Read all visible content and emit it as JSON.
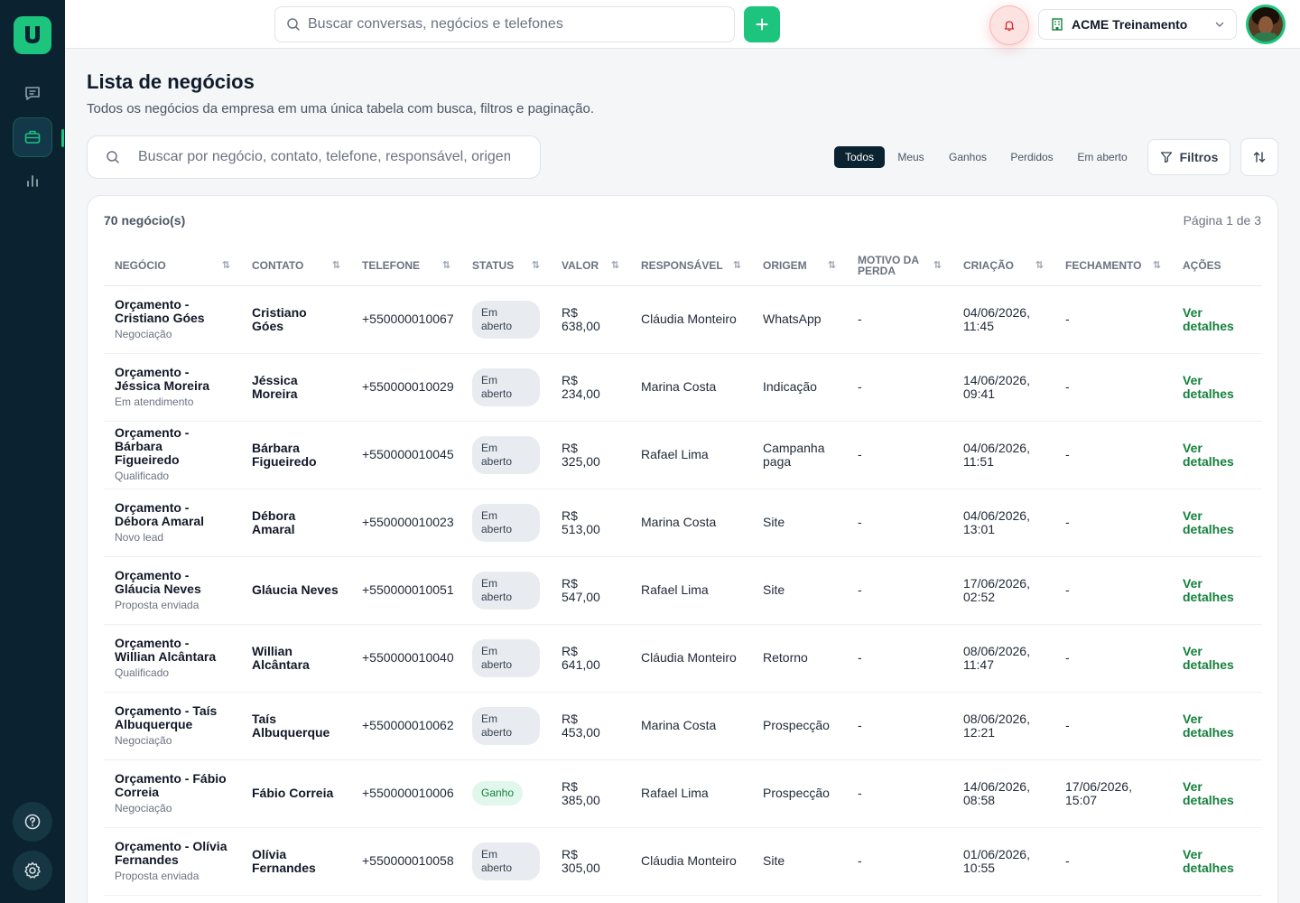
{
  "topbar": {
    "search_placeholder": "Buscar conversas, negócios e telefones",
    "company_name": "ACME Treinamento"
  },
  "page": {
    "title": "Lista de negócios",
    "subtitle": "Todos os negócios da empresa em uma única tabela com busca, filtros e paginação."
  },
  "filters": {
    "search_placeholder": "Buscar por negócio, contato, telefone, responsável, origem",
    "segments": [
      "Todos",
      "Meus",
      "Ganhos",
      "Perdidos",
      "Em aberto"
    ],
    "active_segment": "Todos",
    "filters_label": "Filtros"
  },
  "table": {
    "count_label": "70 negócio(s)",
    "pagination_label": "Página 1 de 3",
    "columns": [
      "Negócio",
      "Contato",
      "Telefone",
      "Status",
      "Valor",
      "Responsável",
      "Origem",
      "Motivo da perda",
      "Criação",
      "Fechamento",
      "Ações"
    ],
    "rows": [
      {
        "deal": "Orçamento - Cristiano Góes",
        "stage": "Negociação",
        "contact": "Cristiano Góes",
        "phone": "+550000010067",
        "status": "Em aberto",
        "value": "R$ 638,00",
        "owner": "Cláudia Monteiro",
        "origin": "WhatsApp",
        "loss_reason": "-",
        "created": "04/06/2026, 11:45",
        "closed": "-",
        "action": "Ver detalhes"
      },
      {
        "deal": "Orçamento - Jéssica Moreira",
        "stage": "Em atendimento",
        "contact": "Jéssica Moreira",
        "phone": "+550000010029",
        "status": "Em aberto",
        "value": "R$ 234,00",
        "owner": "Marina Costa",
        "origin": "Indicação",
        "loss_reason": "-",
        "created": "14/06/2026, 09:41",
        "closed": "-",
        "action": "Ver detalhes"
      },
      {
        "deal": "Orçamento - Bárbara Figueiredo",
        "stage": "Qualificado",
        "contact": "Bárbara Figueiredo",
        "phone": "+550000010045",
        "status": "Em aberto",
        "value": "R$ 325,00",
        "owner": "Rafael Lima",
        "origin": "Campanha paga",
        "loss_reason": "-",
        "created": "04/06/2026, 11:51",
        "closed": "-",
        "action": "Ver detalhes"
      },
      {
        "deal": "Orçamento - Débora Amaral",
        "stage": "Novo lead",
        "contact": "Débora Amaral",
        "phone": "+550000010023",
        "status": "Em aberto",
        "value": "R$ 513,00",
        "owner": "Marina Costa",
        "origin": "Site",
        "loss_reason": "-",
        "created": "04/06/2026, 13:01",
        "closed": "-",
        "action": "Ver detalhes"
      },
      {
        "deal": "Orçamento - Gláucia Neves",
        "stage": "Proposta enviada",
        "contact": "Gláucia Neves",
        "phone": "+550000010051",
        "status": "Em aberto",
        "value": "R$ 547,00",
        "owner": "Rafael Lima",
        "origin": "Site",
        "loss_reason": "-",
        "created": "17/06/2026, 02:52",
        "closed": "-",
        "action": "Ver detalhes"
      },
      {
        "deal": "Orçamento - Willian Alcântara",
        "stage": "Qualificado",
        "contact": "Willian Alcântara",
        "phone": "+550000010040",
        "status": "Em aberto",
        "value": "R$ 641,00",
        "owner": "Cláudia Monteiro",
        "origin": "Retorno",
        "loss_reason": "-",
        "created": "08/06/2026, 11:47",
        "closed": "-",
        "action": "Ver detalhes"
      },
      {
        "deal": "Orçamento - Taís Albuquerque",
        "stage": "Negociação",
        "contact": "Taís Albuquerque",
        "phone": "+550000010062",
        "status": "Em aberto",
        "value": "R$ 453,00",
        "owner": "Marina Costa",
        "origin": "Prospecção",
        "loss_reason": "-",
        "created": "08/06/2026, 12:21",
        "closed": "-",
        "action": "Ver detalhes"
      },
      {
        "deal": "Orçamento - Fábio Correia",
        "stage": "Negociação",
        "contact": "Fábio Correia",
        "phone": "+550000010006",
        "status": "Ganho",
        "value": "R$ 385,00",
        "owner": "Rafael Lima",
        "origin": "Prospecção",
        "loss_reason": "-",
        "created": "14/06/2026, 08:58",
        "closed": "17/06/2026, 15:07",
        "action": "Ver detalhes"
      },
      {
        "deal": "Orçamento - Olívia Fernandes",
        "stage": "Proposta enviada",
        "contact": "Olívia Fernandes",
        "phone": "+550000010058",
        "status": "Em aberto",
        "value": "R$ 305,00",
        "owner": "Cláudia Monteiro",
        "origin": "Site",
        "loss_reason": "-",
        "created": "01/06/2026, 10:55",
        "closed": "-",
        "action": "Ver detalhes"
      }
    ]
  },
  "colors": {
    "sidebar": "#0b2230",
    "accent": "#1cc47e",
    "link": "#15803d",
    "won_badge": "#e2f7ec"
  }
}
